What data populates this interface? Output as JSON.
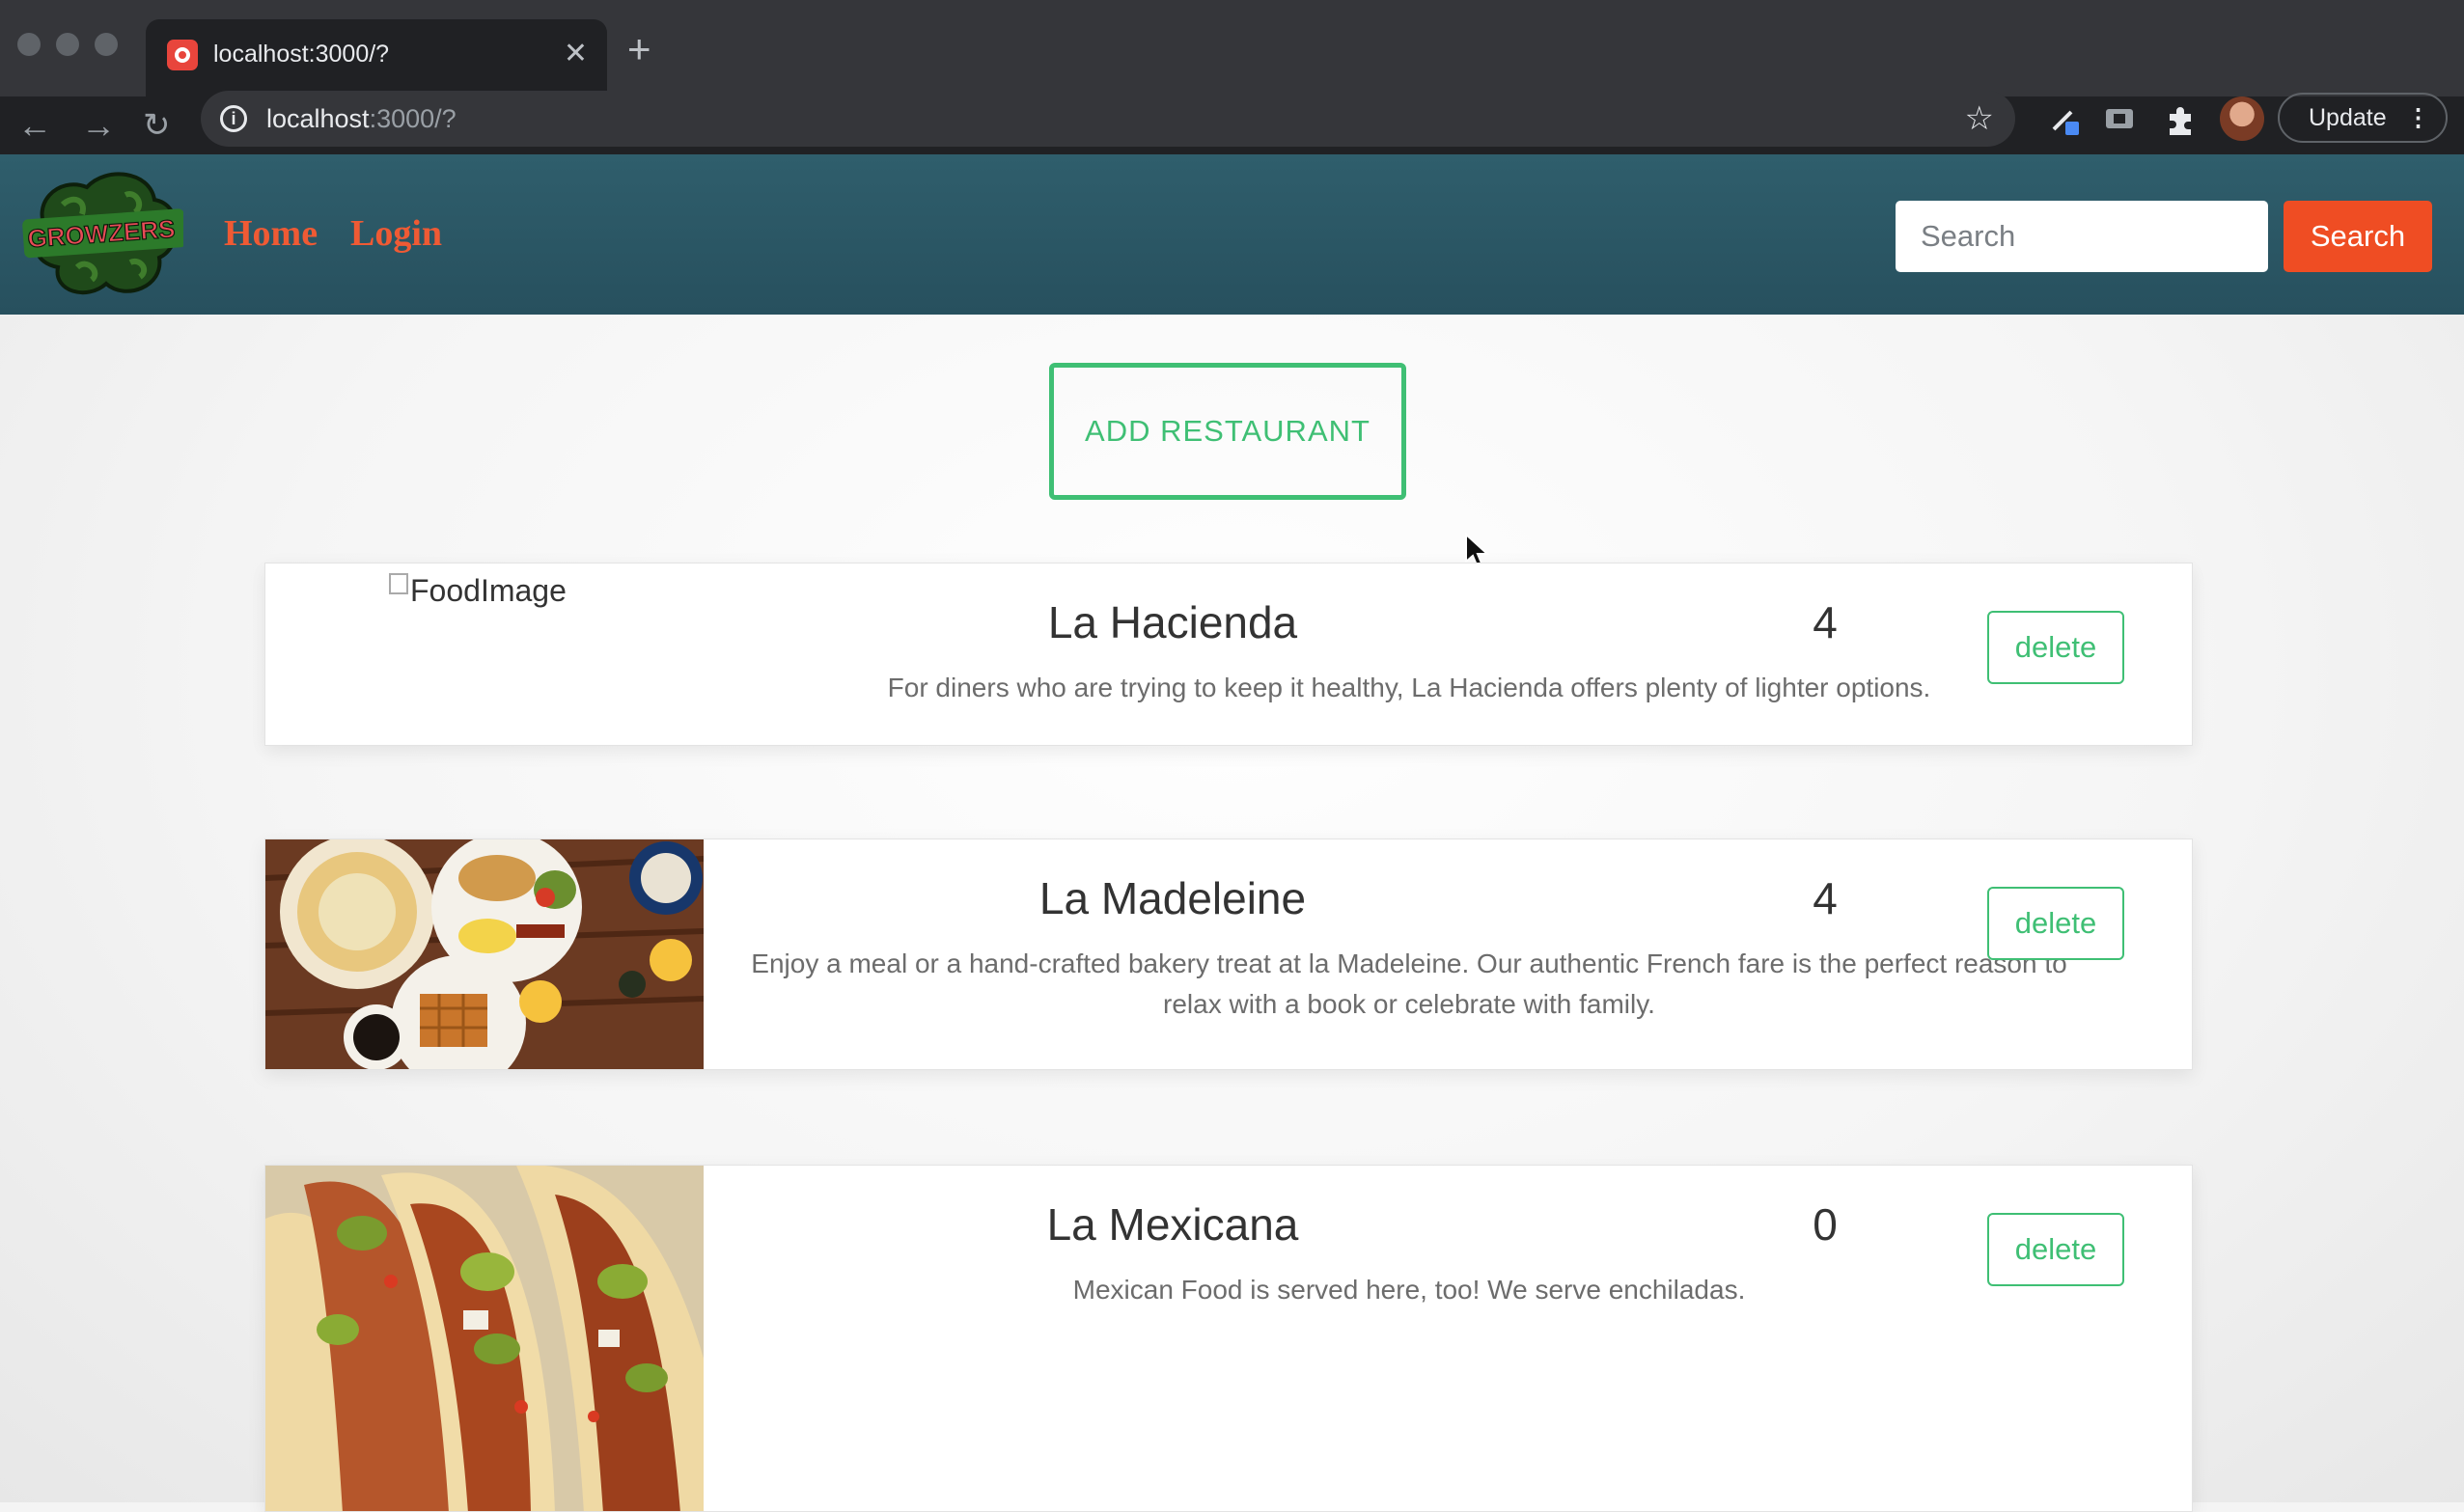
{
  "browser": {
    "tab_title": "localhost:3000/?",
    "tab_close": "✕",
    "new_tab": "+",
    "url_host": "localhost",
    "url_rest": ":3000/?",
    "update_label": "Update"
  },
  "navbar": {
    "logo_text": "GROWZERS",
    "links": [
      "Home",
      "Login"
    ],
    "search_placeholder": "Search",
    "search_button": "Search"
  },
  "main": {
    "add_button": "ADD RESTAURANT",
    "restaurants": [
      {
        "name": "La Hacienda",
        "rating": "4",
        "description": "For diners who are trying to keep it healthy, La Hacienda offers plenty of lighter options.",
        "image_alt": "FoodImage",
        "image": "broken",
        "delete_label": "delete"
      },
      {
        "name": "La Madeleine",
        "rating": "4",
        "description": "Enjoy a meal or a hand-crafted bakery treat at la Madeleine. Our authentic French fare is the perfect reason to relax with a book or celebrate with family.",
        "image": "breakfast-photo",
        "delete_label": "delete"
      },
      {
        "name": "La Mexicana",
        "rating": "0",
        "description": "Mexican Food is served here, too! We serve enchiladas.",
        "image": "tacos-photo",
        "delete_label": "delete"
      }
    ]
  },
  "colors": {
    "navbar_bg": "#2c5866",
    "nav_link": "#ef5a34",
    "search_button_bg": "#ef4d23",
    "accent_green": "#3fbf74"
  }
}
